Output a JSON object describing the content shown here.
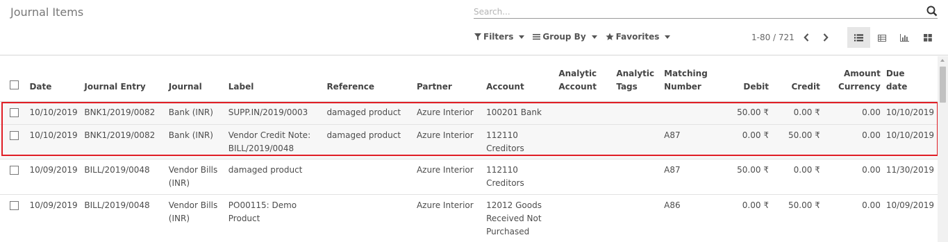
{
  "page": {
    "title": "Journal Items"
  },
  "search": {
    "placeholder": "Search..."
  },
  "filters": {
    "filters_label": "Filters",
    "groupby_label": "Group By",
    "favorites_label": "Favorites"
  },
  "pager": {
    "range": "1-80 / 721"
  },
  "views": [
    "list",
    "pivot",
    "graph",
    "kanban"
  ],
  "columns": {
    "date": "Date",
    "journal_entry": "Journal Entry",
    "journal": "Journal",
    "label": "Label",
    "reference": "Reference",
    "partner": "Partner",
    "account": "Account",
    "analytic_account": [
      "Analytic",
      "Account"
    ],
    "analytic_tags": [
      "Analytic",
      "Tags"
    ],
    "matching_number": [
      "Matching",
      "Number"
    ],
    "debit": "Debit",
    "credit": "Credit",
    "amount_currency": [
      "Amount",
      "Currency"
    ],
    "due_date": [
      "Due",
      "date"
    ]
  },
  "rows": [
    {
      "date": "10/10/2019",
      "journal_entry": "BNK1/2019/0082",
      "journal": "Bank (INR)",
      "label": "SUPP.IN/2019/0003",
      "reference": "damaged product",
      "partner": "Azure Interior",
      "account": "100201 Bank",
      "analytic_account": "",
      "analytic_tags": "",
      "matching_number": "",
      "debit": "50.00 ₹",
      "credit": "0.00 ₹",
      "amount_currency": "0.00",
      "due_date": "10/10/2019",
      "highlighted": true
    },
    {
      "date": "10/10/2019",
      "journal_entry": "BNK1/2019/0082",
      "journal": "Bank (INR)",
      "label": "Vendor Credit Note: BILL/2019/0048",
      "reference": "damaged product",
      "partner": "Azure Interior",
      "account": "112110 Creditors",
      "analytic_account": "",
      "analytic_tags": "",
      "matching_number": "A87",
      "debit": "0.00 ₹",
      "credit": "50.00 ₹",
      "amount_currency": "0.00",
      "due_date": "10/10/2019",
      "highlighted": true
    },
    {
      "date": "10/09/2019",
      "journal_entry": "BILL/2019/0048",
      "journal": "Vendor Bills (INR)",
      "label": "damaged product",
      "reference": "",
      "partner": "Azure Interior",
      "account": "112110 Creditors",
      "analytic_account": "",
      "analytic_tags": "",
      "matching_number": "A87",
      "debit": "50.00 ₹",
      "credit": "0.00 ₹",
      "amount_currency": "0.00",
      "due_date": "11/30/2019",
      "highlighted": false
    },
    {
      "date": "10/09/2019",
      "journal_entry": "BILL/2019/0048",
      "journal": "Vendor Bills (INR)",
      "label": "PO00115: Demo Product",
      "reference": "",
      "partner": "Azure Interior",
      "account": "12012 Goods Received Not Purchased",
      "analytic_account": "",
      "analytic_tags": "",
      "matching_number": "A86",
      "debit": "0.00 ₹",
      "credit": "50.00 ₹",
      "amount_currency": "0.00",
      "due_date": "10/09/2019",
      "highlighted": false
    }
  ],
  "colors": {
    "highlight_border": "#e01e25",
    "row_highlight_bg": "#f7f7f7"
  }
}
